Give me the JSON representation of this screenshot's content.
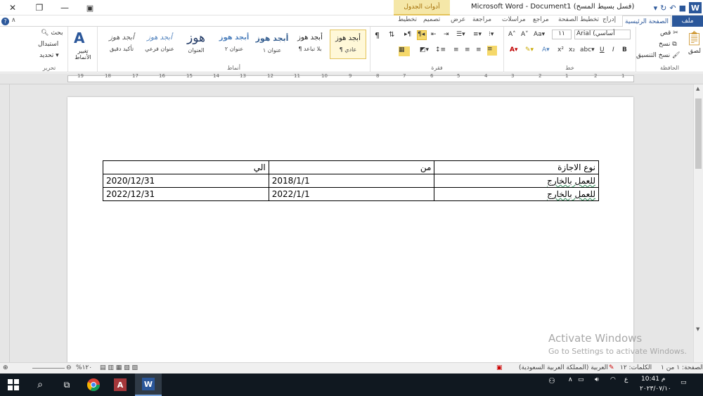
{
  "window": {
    "title": "Microsoft Word - Document1 (فسل بسيط المسح)",
    "table_tools": "أدوات الجدول"
  },
  "tabs": {
    "file": "ملف",
    "home": "الصفحة الرئيسية",
    "insert": "إدراج",
    "page_layout": "تخطيط الصفحة",
    "references": "مراجع",
    "mailings": "مراسلات",
    "review": "مراجعة",
    "view": "عرض",
    "design": "تصميم",
    "layout": "تخطيط"
  },
  "ribbon": {
    "clipboard": {
      "label": "الحافظة",
      "paste": "لصق",
      "cut": "قص",
      "copy": "نسخ",
      "format_painter": "نسخ التنسيق"
    },
    "font": {
      "label": "خط",
      "font_name": "Arial (أساسي",
      "font_size": "١١",
      "bold": "B",
      "italic": "I",
      "underline": "U"
    },
    "paragraph": {
      "label": "فقرة"
    },
    "styles": {
      "label": "أنماط",
      "change_styles": "تغيير الأنماط",
      "items": [
        {
          "sample": "أبجد هوز",
          "name": "¶ عادي"
        },
        {
          "sample": "أبجد هوز",
          "name": "¶ بلا تباعد"
        },
        {
          "sample": "أبجد هوز",
          "name": "عنوان ١"
        },
        {
          "sample": "أبجد هوز",
          "name": "عنوان ٢"
        },
        {
          "sample": "هوز",
          "name": "العنوان"
        },
        {
          "sample": "أبجد هوز",
          "name": "عنوان فرعي"
        },
        {
          "sample": "أبجد هوز",
          "name": "تأكيد دقيق"
        }
      ]
    },
    "editing": {
      "label": "تحرير",
      "find": "بحث",
      "replace": "استبدال",
      "select": "تحديد"
    }
  },
  "ruler": {
    "numbers": [
      "1",
      "2",
      "1",
      "2",
      "3",
      "4",
      "5",
      "6",
      "7",
      "8",
      "9",
      "10",
      "11",
      "12",
      "13",
      "14",
      "15",
      "16",
      "17",
      "18",
      "19"
    ]
  },
  "document": {
    "table": {
      "headers": [
        "نوع الاجازة",
        "من",
        "الي"
      ],
      "rows": [
        [
          "للعمل بالخارج",
          "2018/1/1",
          "2020/12/31"
        ],
        [
          "للعمل بالخارج",
          "2022/1/1",
          "2022/12/31"
        ]
      ]
    }
  },
  "watermark": {
    "line1": "Activate Windows",
    "line2": "Go to Settings to activate Windows."
  },
  "status": {
    "page": "الصفحة: ١ من ١",
    "words": "الكلمات: ١٢",
    "language": "العربية (المملكة العربية السعودية)",
    "zoom": "%١٢٠"
  },
  "taskbar": {
    "time": "10:41 م",
    "date": "٢٠٢٣/٠٧/١٠",
    "lang": "ع"
  }
}
